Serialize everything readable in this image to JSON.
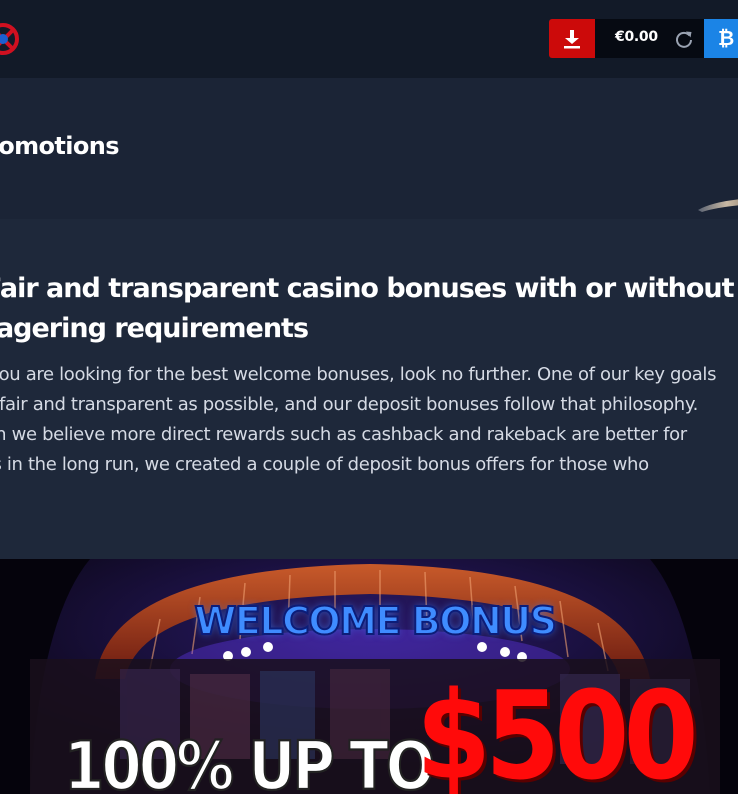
{
  "header": {
    "logo_icon": "logo-icon",
    "download_icon": "download-icon",
    "balance": "€0.00",
    "refresh_icon": "refresh-icon",
    "crypto_icon": "bitcoin-icon",
    "crypto_symbol": "₿"
  },
  "page": {
    "title": "Promotions"
  },
  "content": {
    "heading_lines": [
      "Fair and transparent casino bonuses with or without",
      "wagering requirements"
    ],
    "paragraph_lines": [
      "If you are looking for the best welcome bonuses, look no further. One of our key goals",
      "is to be fair and transparent as possible, and our deposit bonuses follow that philosophy.",
      "Although we believe more direct rewards such as cashback and rakeback are better for",
      "players in the long run, we created a couple of deposit bonus offers for those who"
    ]
  },
  "banner": {
    "headline": "WELCOME BONUS",
    "offer_prefix": "100% UP TO",
    "offer_amount": "$500"
  },
  "colors": {
    "header_bg": "#121a28",
    "content_bg": "#1e283a",
    "download_red": "#cc0a0a",
    "crypto_blue": "#1b84e6",
    "banner_amount_red": "#ff0a0a",
    "banner_headline_blue": "#3f8cff"
  }
}
